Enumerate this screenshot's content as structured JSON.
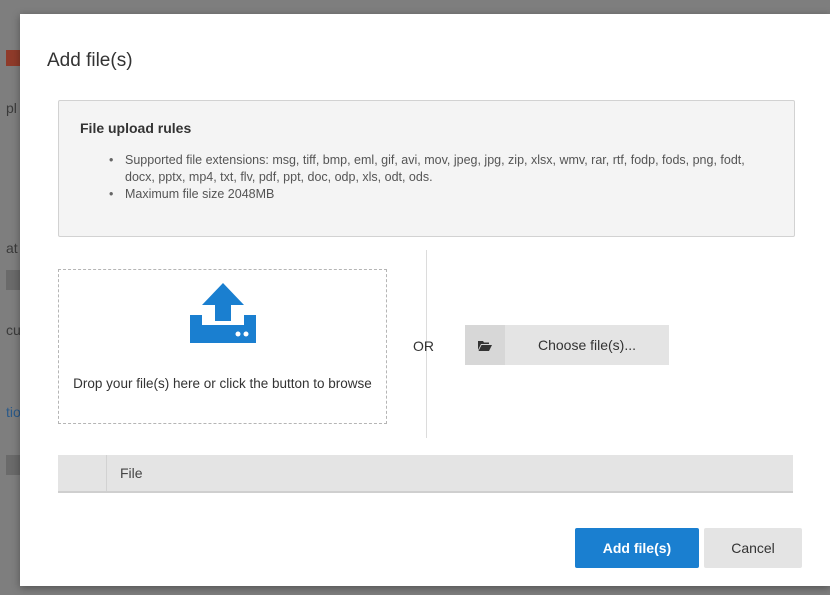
{
  "background": {
    "fragments": [
      "pl",
      "at",
      "cu",
      "tio"
    ]
  },
  "dialog": {
    "title": "Add file(s)",
    "rules": {
      "title": "File upload rules",
      "items": [
        "Supported file extensions: msg, tiff, bmp, eml, gif, avi, mov, jpeg, jpg, zip, xlsx, wmv, rar, rtf, fodp, fods, png, fodt, docx, pptx, mp4, txt, flv, pdf, ppt, doc, odp, xls, odt, ods.",
        "Maximum file size 2048MB"
      ]
    },
    "dropzone": {
      "icon": "upload-icon",
      "text": "Drop your file(s) here or click the button to browse"
    },
    "or_label": "OR",
    "choose_button": {
      "icon": "folder-open-icon",
      "label": "Choose file(s)..."
    },
    "file_table": {
      "header": "File"
    },
    "footer": {
      "add_label": "Add file(s)",
      "cancel_label": "Cancel"
    }
  },
  "colors": {
    "accent": "#1a7fd0",
    "overlay": "#7e7e7e",
    "panel": "#f4f4f4",
    "button_gray": "#e4e4e4"
  }
}
